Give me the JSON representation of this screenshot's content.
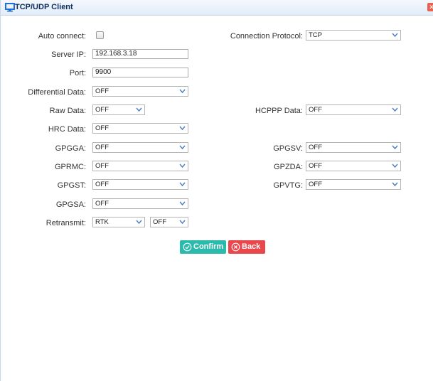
{
  "window": {
    "title": "TCP/UDP Client",
    "close_symbol": "✕"
  },
  "form": {
    "auto_connect": {
      "label": "Auto connect:",
      "checked": false
    },
    "connection_protocol": {
      "label": "Connection Protocol:",
      "value": "TCP"
    },
    "server_ip": {
      "label": "Server IP:",
      "value": "192.168.3.18"
    },
    "port": {
      "label": "Port:",
      "value": "9900"
    },
    "differential_data": {
      "label": "Differential Data:",
      "value": "OFF"
    },
    "raw_data": {
      "label": "Raw Data:",
      "value": "OFF"
    },
    "hcppp_data": {
      "label": "HCPPP Data:",
      "value": "OFF"
    },
    "hrc_data": {
      "label": "HRC Data:",
      "value": "OFF"
    },
    "gpgga": {
      "label": "GPGGA:",
      "value": "OFF"
    },
    "gpgsv": {
      "label": "GPGSV:",
      "value": "OFF"
    },
    "gprmc": {
      "label": "GPRMC:",
      "value": "OFF"
    },
    "gpzda": {
      "label": "GPZDA:",
      "value": "OFF"
    },
    "gpgst": {
      "label": "GPGST:",
      "value": "OFF"
    },
    "gpvtg": {
      "label": "GPVTG:",
      "value": "OFF"
    },
    "gpgsa": {
      "label": "GPGSA:",
      "value": "OFF"
    },
    "retransmit": {
      "label": "Retransmit:",
      "value": "RTK",
      "value2": "OFF"
    }
  },
  "buttons": {
    "confirm": "Confirm",
    "back": "Back"
  },
  "colors": {
    "confirm": "#2bbbad",
    "back": "#e9474b",
    "title": "#0e2d5f",
    "accent_icon": "#1e6fd9"
  },
  "icons": {
    "title": "monitor-icon",
    "close": "close-icon",
    "dropdown": "chevron-down-icon",
    "confirm": "check-circle-icon",
    "back": "x-circle-icon"
  }
}
